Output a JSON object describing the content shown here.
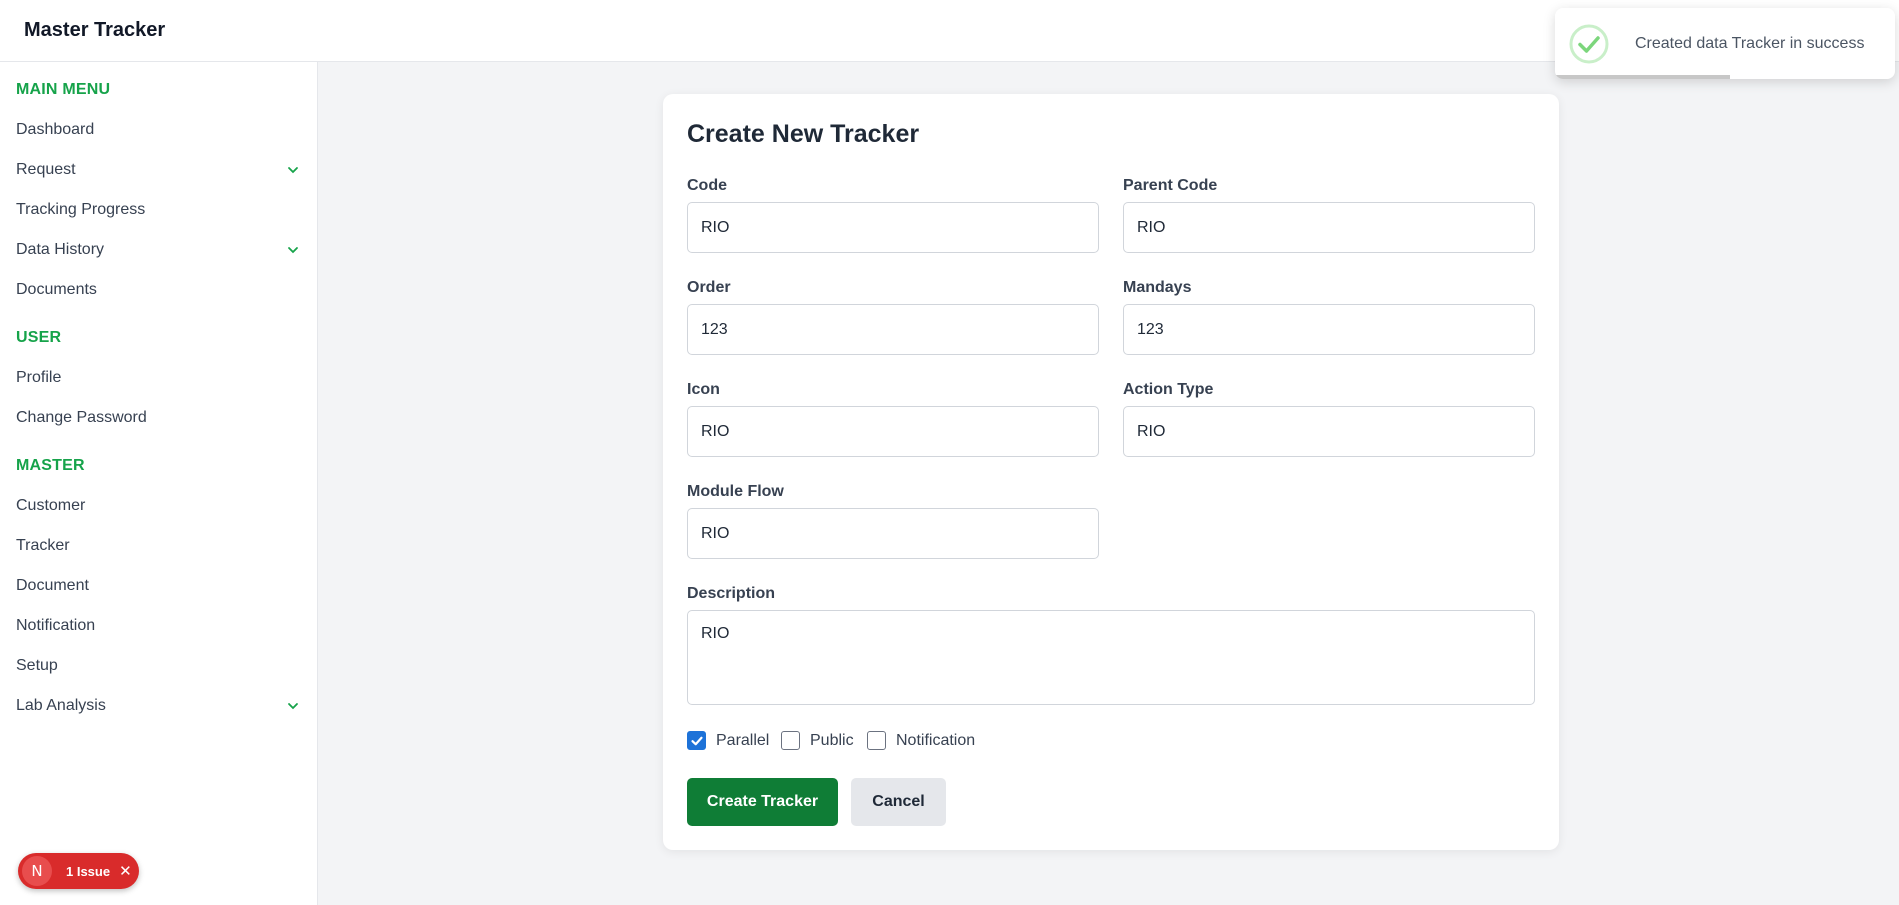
{
  "app": {
    "title": "Master Tracker"
  },
  "sidebar": {
    "sections": [
      {
        "title": "MAIN MENU",
        "items": [
          {
            "label": "Dashboard",
            "has_children": false
          },
          {
            "label": "Request",
            "has_children": true
          },
          {
            "label": "Tracking Progress",
            "has_children": false
          },
          {
            "label": "Data History",
            "has_children": true
          },
          {
            "label": "Documents",
            "has_children": false
          }
        ]
      },
      {
        "title": "USER",
        "items": [
          {
            "label": "Profile",
            "has_children": false
          },
          {
            "label": "Change Password",
            "has_children": false
          }
        ]
      },
      {
        "title": "MASTER",
        "items": [
          {
            "label": "Customer",
            "has_children": false
          },
          {
            "label": "Tracker",
            "has_children": false
          },
          {
            "label": "Document",
            "has_children": false
          },
          {
            "label": "Notification",
            "has_children": false
          },
          {
            "label": "Setup",
            "has_children": false
          },
          {
            "label": "Lab Analysis",
            "has_children": true
          }
        ]
      }
    ]
  },
  "form": {
    "title": "Create New Tracker",
    "fields": {
      "code": {
        "label": "Code",
        "value": "RIO"
      },
      "parent_code": {
        "label": "Parent Code",
        "value": "RIO"
      },
      "order": {
        "label": "Order",
        "value": "123"
      },
      "mandays": {
        "label": "Mandays",
        "value": "123"
      },
      "icon": {
        "label": "Icon",
        "value": "RIO"
      },
      "action_type": {
        "label": "Action Type",
        "value": "RIO"
      },
      "module_flow": {
        "label": "Module Flow",
        "value": "RIO"
      },
      "description": {
        "label": "Description",
        "value": "RIO"
      }
    },
    "checkboxes": {
      "parallel": {
        "label": "Parallel",
        "checked": true
      },
      "public": {
        "label": "Public",
        "checked": false
      },
      "notification": {
        "label": "Notification",
        "checked": false
      }
    },
    "submit_label": "Create Tracker",
    "cancel_label": "Cancel"
  },
  "toast": {
    "message": "Created data Tracker in success",
    "icon": "check-circle-icon"
  },
  "issue_badge": {
    "letter": "N",
    "label": "1 Issue"
  },
  "colors": {
    "accent_green": "#16a34a",
    "primary_button": "#0f7d36",
    "checkbox_checked": "#1d72d8",
    "issue_red": "#d92b2b"
  }
}
